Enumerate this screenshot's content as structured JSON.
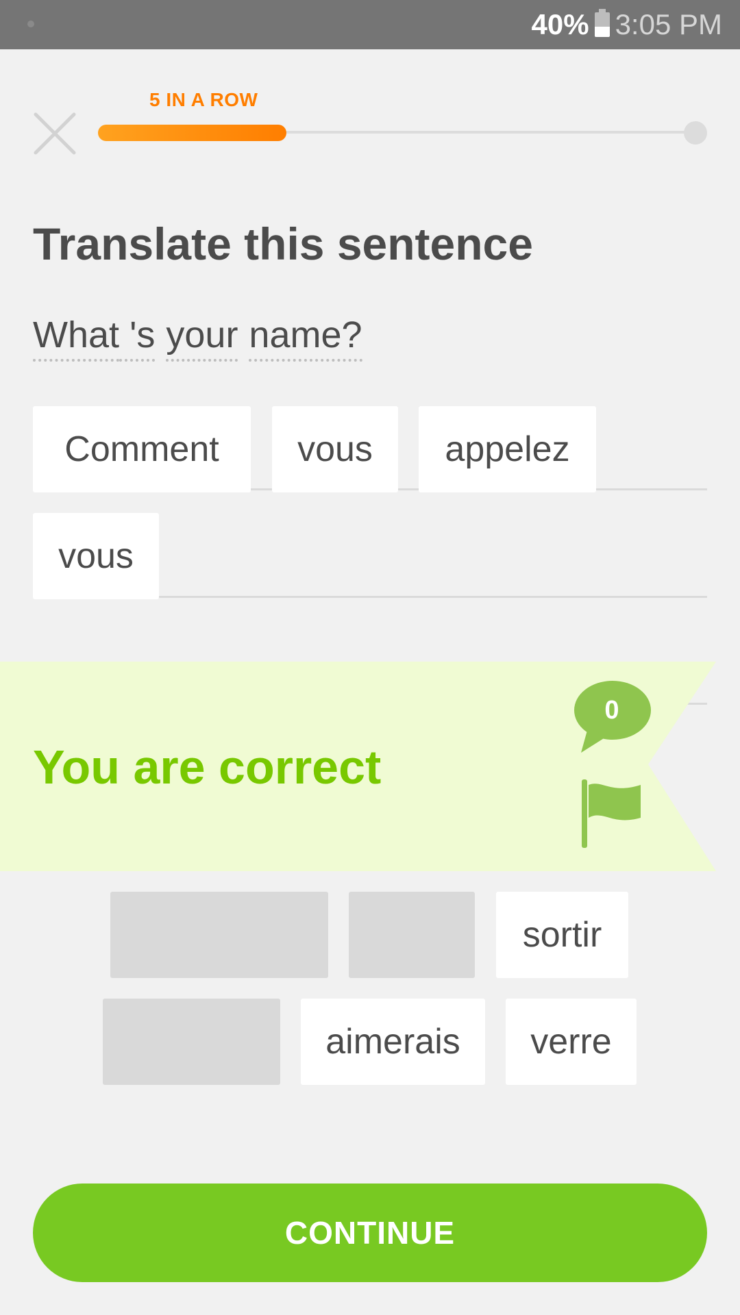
{
  "status_bar": {
    "battery": "40%",
    "time": "3:05 PM"
  },
  "progress": {
    "streak_label": "5 IN A ROW",
    "fraction": 0.3
  },
  "exercise": {
    "title": "Translate this sentence",
    "prompt_tokens": [
      "What",
      "'s",
      "your",
      "name?"
    ]
  },
  "answer": {
    "row1": [
      "Comment",
      "vous",
      "appelez"
    ],
    "row2": [
      "vous"
    ]
  },
  "feedback": {
    "message": "You are correct",
    "comment_count": "0"
  },
  "word_bank": {
    "row1": [
      "",
      "",
      "sortir"
    ],
    "row2": [
      "",
      "aimerais",
      "verre"
    ]
  },
  "continue_label": "CONTINUE",
  "colors": {
    "accent_green": "#78c922",
    "streak_orange": "#ff7e00",
    "banner_bg": "#f0fbd3"
  }
}
